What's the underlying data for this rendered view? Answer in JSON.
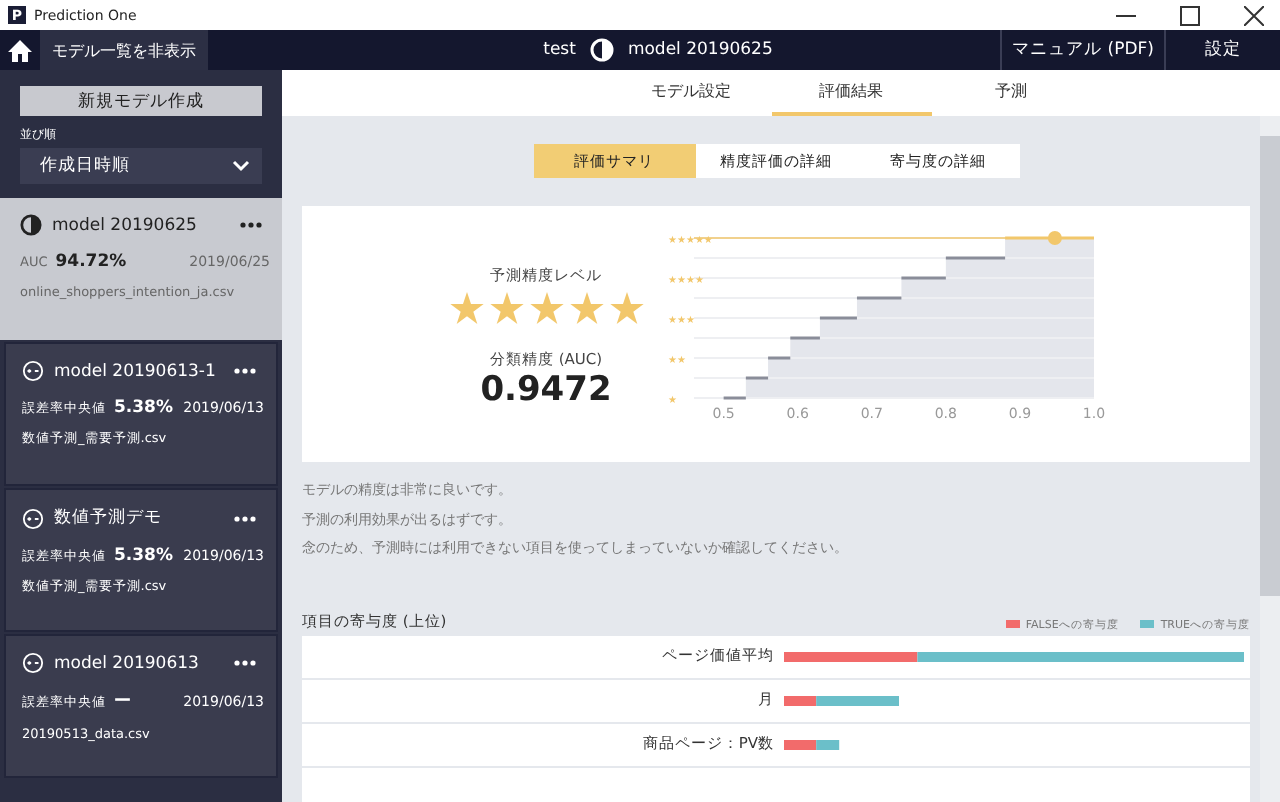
{
  "window": {
    "logo": "P",
    "title": "Prediction One"
  },
  "header": {
    "toggle_label": "モデル一覧を非表示",
    "project": "test",
    "model": "model 20190625",
    "manual": "マニュアル (PDF)",
    "settings": "設定"
  },
  "sidebar": {
    "new_button": "新規モデル作成",
    "sort_label": "並び順",
    "sort_value": "作成日時順",
    "models": [
      {
        "kind": "classification",
        "name": "model 20190625",
        "metric_label": "AUC",
        "metric": "94.72%",
        "date": "2019/06/25",
        "file": "online_shoppers_intention_ja.csv",
        "selected": true
      },
      {
        "kind": "regression",
        "name": "model 20190613-1",
        "metric_label": "誤差率中央値",
        "metric": "5.38%",
        "date": "2019/06/13",
        "file": "数値予測_需要予測.csv",
        "selected": false
      },
      {
        "kind": "regression",
        "name": "数値予測デモ",
        "metric_label": "誤差率中央値",
        "metric": "5.38%",
        "date": "2019/06/13",
        "file": "数値予測_需要予測.csv",
        "selected": false
      },
      {
        "kind": "regression",
        "name": "model 20190613",
        "metric_label": "誤差率中央値",
        "metric": "ー",
        "date": "2019/06/13",
        "file": "20190513_data.csv",
        "selected": false
      }
    ]
  },
  "tabs": [
    {
      "label": "モデル設定",
      "selected": false
    },
    {
      "label": "評価結果",
      "selected": true
    },
    {
      "label": "予測",
      "selected": false
    }
  ],
  "subtabs": [
    {
      "label": "評価サマリ",
      "selected": true
    },
    {
      "label": "精度評価の詳細",
      "selected": false
    },
    {
      "label": "寄与度の詳細",
      "selected": false
    }
  ],
  "summary": {
    "level_label": "予測精度レベル",
    "stars": 5,
    "auc_label": "分類精度 (AUC)",
    "auc_value": "0.9472",
    "level_chart": {
      "star_labels": [
        "★★★★★",
        "★★★★",
        "★★★",
        "★★",
        "★"
      ],
      "x_labels": [
        "0.5",
        "0.6",
        "0.7",
        "0.8",
        "0.9",
        "1.0"
      ]
    }
  },
  "comment": [
    "モデルの精度は非常に良いです。",
    "予測の利用効果が出るはずです。",
    "念のため、予測時には利用できない項目を使ってしまっていないか確認してください。"
  ],
  "contribution": {
    "title": "項目の寄与度 (上位)",
    "legend": [
      {
        "label": "FALSEへの寄与度",
        "color": "#f26b6b"
      },
      {
        "label": "TRUEへの寄与度",
        "color": "#6bbfc9"
      }
    ],
    "rows": [
      {
        "label": "ページ価値平均"
      },
      {
        "label": "月"
      },
      {
        "label": "商品ページ：PV数"
      }
    ]
  }
}
